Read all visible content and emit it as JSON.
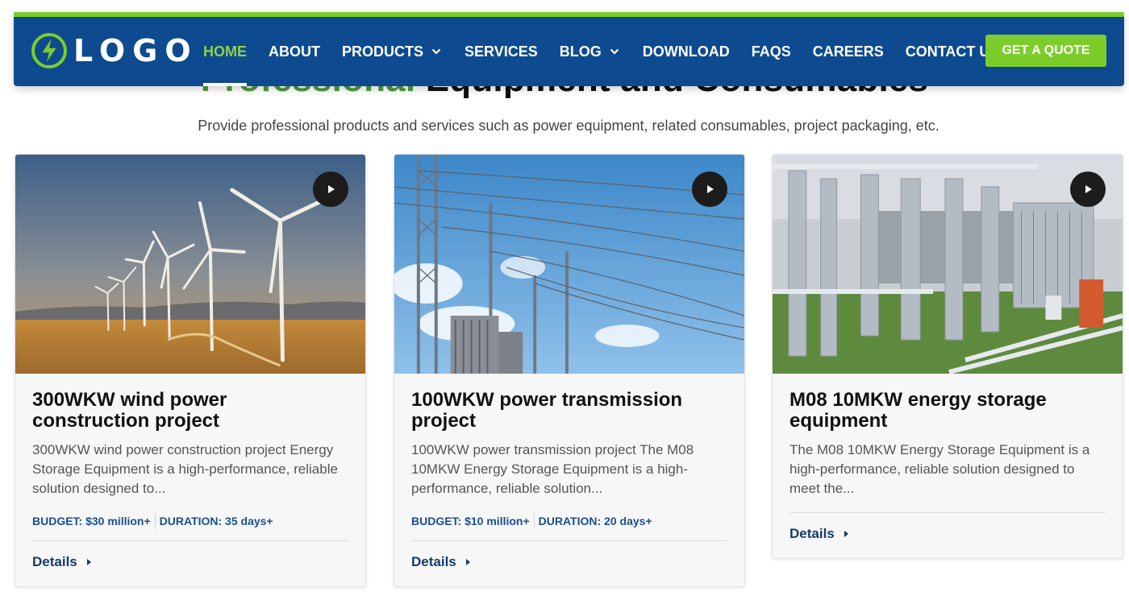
{
  "section": {
    "title_accent": "Professional",
    "title_rest": " Equipment and Consumables",
    "subtitle": "Provide professional products and services such as power equipment, related consumables, project packaging, etc."
  },
  "header": {
    "logo_text": "LOGO",
    "nav": [
      {
        "label": "HOME",
        "active": true
      },
      {
        "label": "ABOUT"
      },
      {
        "label": "PRODUCTS",
        "dropdown": true
      },
      {
        "label": "SERVICES"
      },
      {
        "label": "BLOG",
        "dropdown": true
      },
      {
        "label": "DOWNLOAD"
      },
      {
        "label": "FAQS"
      },
      {
        "label": "CAREERS"
      },
      {
        "label": "CONTACT US"
      }
    ],
    "cta_label": "GET A QUOTE"
  },
  "colors": {
    "header_bg": "#0d4a8f",
    "accent_green": "#7ccd2b",
    "meta_blue": "#1a4f8b"
  },
  "cards": [
    {
      "title": "300WKW wind power construction project",
      "description": "300WKW wind power construction project Energy Storage Equipment is a high-performance, reliable solution designed to...",
      "budget": "BUDGET: $30 million+",
      "duration": "DURATION: 35 days+",
      "details_label": "Details",
      "image_icon": "wind-turbines-photo"
    },
    {
      "title": "100WKW power transmission project",
      "description": "100WKW power transmission project The M08 10MKW Energy Storage Equipment is a high-performance, reliable solution...",
      "budget": "BUDGET: $10 million+",
      "duration": "DURATION: 20 days+",
      "details_label": "Details",
      "image_icon": "transmission-tower-photo"
    },
    {
      "title": "M08 10MKW energy storage equipment",
      "description": "The M08 10MKW Energy Storage Equipment is a high-performance, reliable solution designed to meet the...",
      "details_label": "Details",
      "image_icon": "substation-photo"
    }
  ]
}
